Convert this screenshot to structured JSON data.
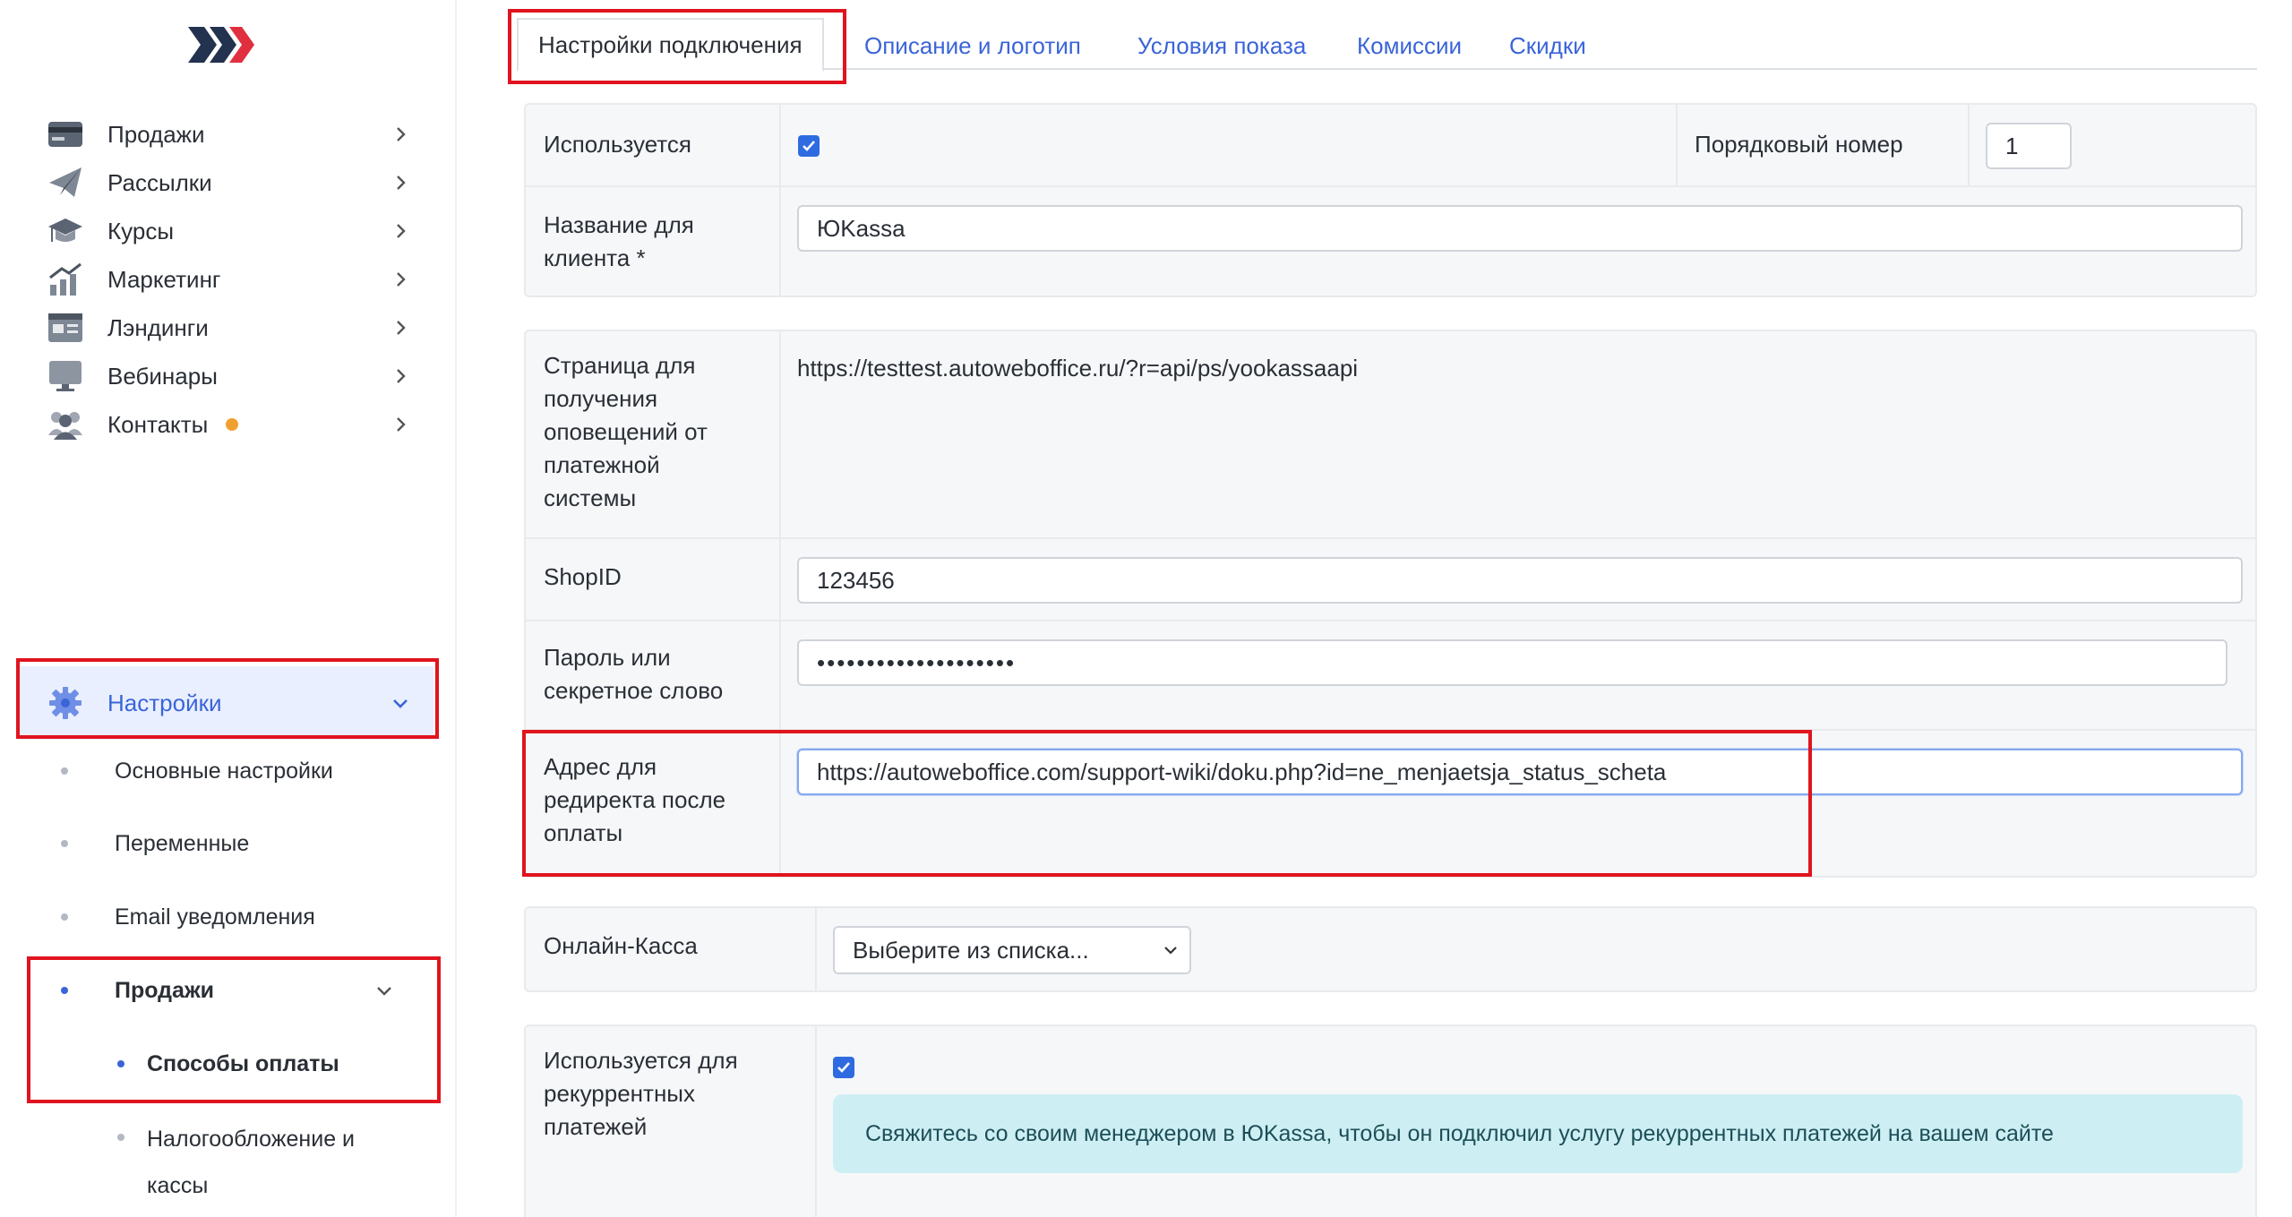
{
  "sidebar": {
    "logo_colors": {
      "dark": "#23324f",
      "red": "#e03040"
    },
    "items": [
      {
        "label": "Продажи",
        "icon": "card-icon"
      },
      {
        "label": "Рассылки",
        "icon": "paper-plane-icon"
      },
      {
        "label": "Курсы",
        "icon": "graduation-cap-icon"
      },
      {
        "label": "Маркетинг",
        "icon": "bar-chart-icon"
      },
      {
        "label": "Лэндинги",
        "icon": "landing-page-icon"
      },
      {
        "label": "Вебинары",
        "icon": "monitor-icon"
      },
      {
        "label": "Контакты",
        "icon": "people-icon"
      },
      {
        "label": "Настройки",
        "icon": "gear-icon"
      }
    ],
    "settings_sub": {
      "basic": "Основные настройки",
      "variables": "Переменные",
      "email": "Email уведомления",
      "sales": "Продажи",
      "payment_methods": "Способы оплаты",
      "taxation": "Налогообложение и кассы"
    }
  },
  "tabs": [
    "Настройки подключения",
    "Описание и логотип",
    "Условия показа",
    "Комиссии",
    "Скидки"
  ],
  "form": {
    "used_label": "Используется",
    "used_checked": true,
    "order_label": "Порядковый номер",
    "order_value": "1",
    "client_name_label": "Название для клиента *",
    "client_name_value": "ЮKassa",
    "notify_label": "Страница для получения оповещений от платежной системы",
    "notify_value": "https://testtest.autoweboffice.ru/?r=api/ps/yookassaapi",
    "shopid_label": "ShopID",
    "shopid_value": "123456",
    "password_label": "Пароль или секретное слово",
    "password_value": "••••••••••••••••••••",
    "redirect_label": "Адрес для редиректа после оплаты",
    "redirect_value": "https://autoweboffice.com/support-wiki/doku.php?id=ne_menjaetsja_status_scheta",
    "online_kassa_label": "Онлайн-Касса",
    "online_kassa_value": "Выберите из списка...",
    "recurrent_label": "Используется для рекуррентных платежей",
    "recurrent_checked": true,
    "recurrent_info": "Свяжитесь со своим менеджером в ЮKassa, чтобы он подключил услугу рекуррентных платежей на вашем сайте"
  },
  "colors": {
    "accent": "#3a64d8",
    "highlight": "#e0141e",
    "checkbox": "#2e6be0",
    "info_bg": "#cdeff3"
  }
}
